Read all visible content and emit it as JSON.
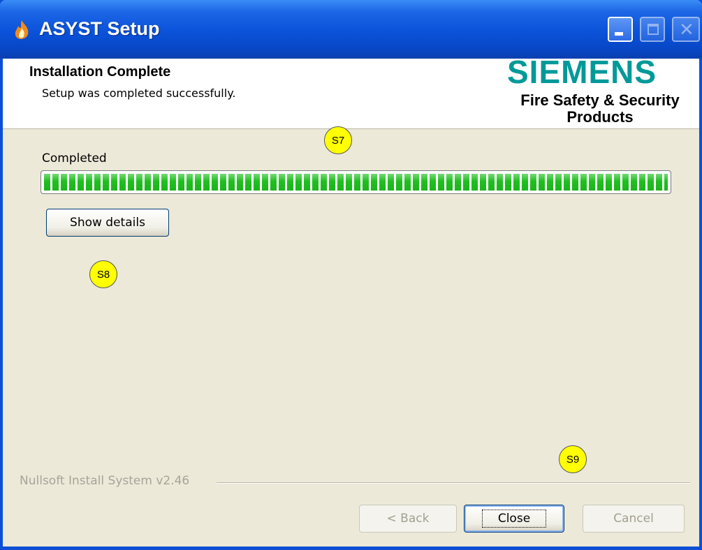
{
  "window": {
    "title": "ASYST Setup"
  },
  "header": {
    "title": "Installation Complete",
    "subtitle": "Setup was completed successfully.",
    "brand": "SIEMENS",
    "brand_tagline": "Fire Safety & Security Products"
  },
  "progress": {
    "label": "Completed",
    "value": 1.0,
    "color": "#1fbf1f"
  },
  "buttons": {
    "show_details": "Show details",
    "back": "< Back",
    "close": "Close",
    "cancel": "Cancel"
  },
  "footer": {
    "branding": "Nullsoft Install System v2.46"
  },
  "callouts": {
    "s7": "S7",
    "s8": "S8",
    "s9": "S9"
  },
  "colors": {
    "titlebar": "#0a52d9",
    "brand": "#009999",
    "callout": "#ffff00"
  }
}
